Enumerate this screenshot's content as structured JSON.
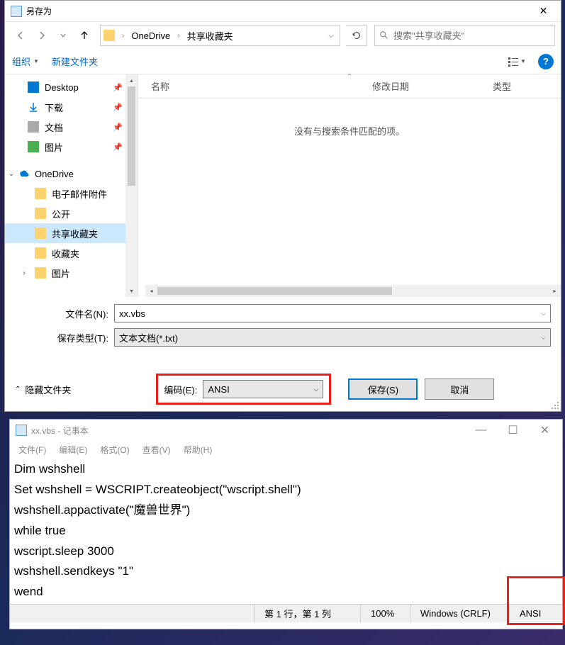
{
  "saveas": {
    "title": "另存为",
    "breadcrumb": {
      "root": "OneDrive",
      "folder": "共享收藏夹"
    },
    "search_placeholder": "搜索\"共享收藏夹\"",
    "toolbar": {
      "organize": "组织",
      "newfolder": "新建文件夹"
    },
    "columns": {
      "name": "名称",
      "date": "修改日期",
      "type": "类型"
    },
    "empty_message": "没有与搜索条件匹配的项。",
    "sidebar": {
      "quick": [
        {
          "label": "Desktop",
          "icon": "desktop"
        },
        {
          "label": "下载",
          "icon": "download"
        },
        {
          "label": "文档",
          "icon": "docs"
        },
        {
          "label": "图片",
          "icon": "pics"
        }
      ],
      "onedrive_label": "OneDrive",
      "onedrive_items": [
        {
          "label": "电子邮件附件"
        },
        {
          "label": "公开"
        },
        {
          "label": "共享收藏夹",
          "selected": true
        },
        {
          "label": "收藏夹"
        },
        {
          "label": "图片"
        }
      ]
    },
    "form": {
      "filename_label": "文件名(N):",
      "filename_value": "xx.vbs",
      "filetype_label": "保存类型(T):",
      "filetype_value": "文本文档(*.txt)"
    },
    "hide_folders": "隐藏文件夹",
    "encoding_label": "编码(E):",
    "encoding_value": "ANSI",
    "save_btn": "保存(S)",
    "cancel_btn": "取消"
  },
  "notepad": {
    "title": "xx.vbs - 记事本",
    "menus": {
      "file": "文件(F)",
      "edit": "编辑(E)",
      "format": "格式(O)",
      "view": "查看(V)",
      "help": "帮助(H)"
    },
    "lines": [
      "Dim wshshell",
      "Set wshshell = WSCRIPT.createobject(\"wscript.shell\")",
      "wshshell.appactivate(\"魔兽世界\")",
      "while true",
      "wscript.sleep 3000",
      "wshshell.sendkeys \"1\"",
      "wend"
    ],
    "status": {
      "position": "第 1 行，第 1 列",
      "zoom": "100%",
      "lineending": "Windows (CRLF)",
      "encoding": "ANSI"
    }
  }
}
